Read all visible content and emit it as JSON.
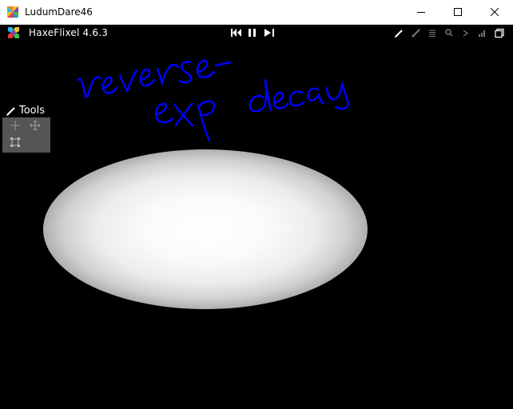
{
  "window": {
    "title": "LudumDare46"
  },
  "debugger": {
    "version_label": "HaxeFlixel 4.6.3",
    "center_buttons": [
      "step-back-icon",
      "pause-icon",
      "play-step-icon"
    ],
    "right_buttons": [
      "pencil-icon",
      "brush-icon",
      "log-icon",
      "watch-icon",
      "console-icon",
      "stats-icon",
      "window-toggle-icon"
    ]
  },
  "tools": {
    "title": "Tools",
    "items": [
      "pointer-icon",
      "mover-icon",
      "transform-icon"
    ]
  },
  "canvas": {
    "background": "#000000",
    "annotation_color": "#0000ff"
  }
}
